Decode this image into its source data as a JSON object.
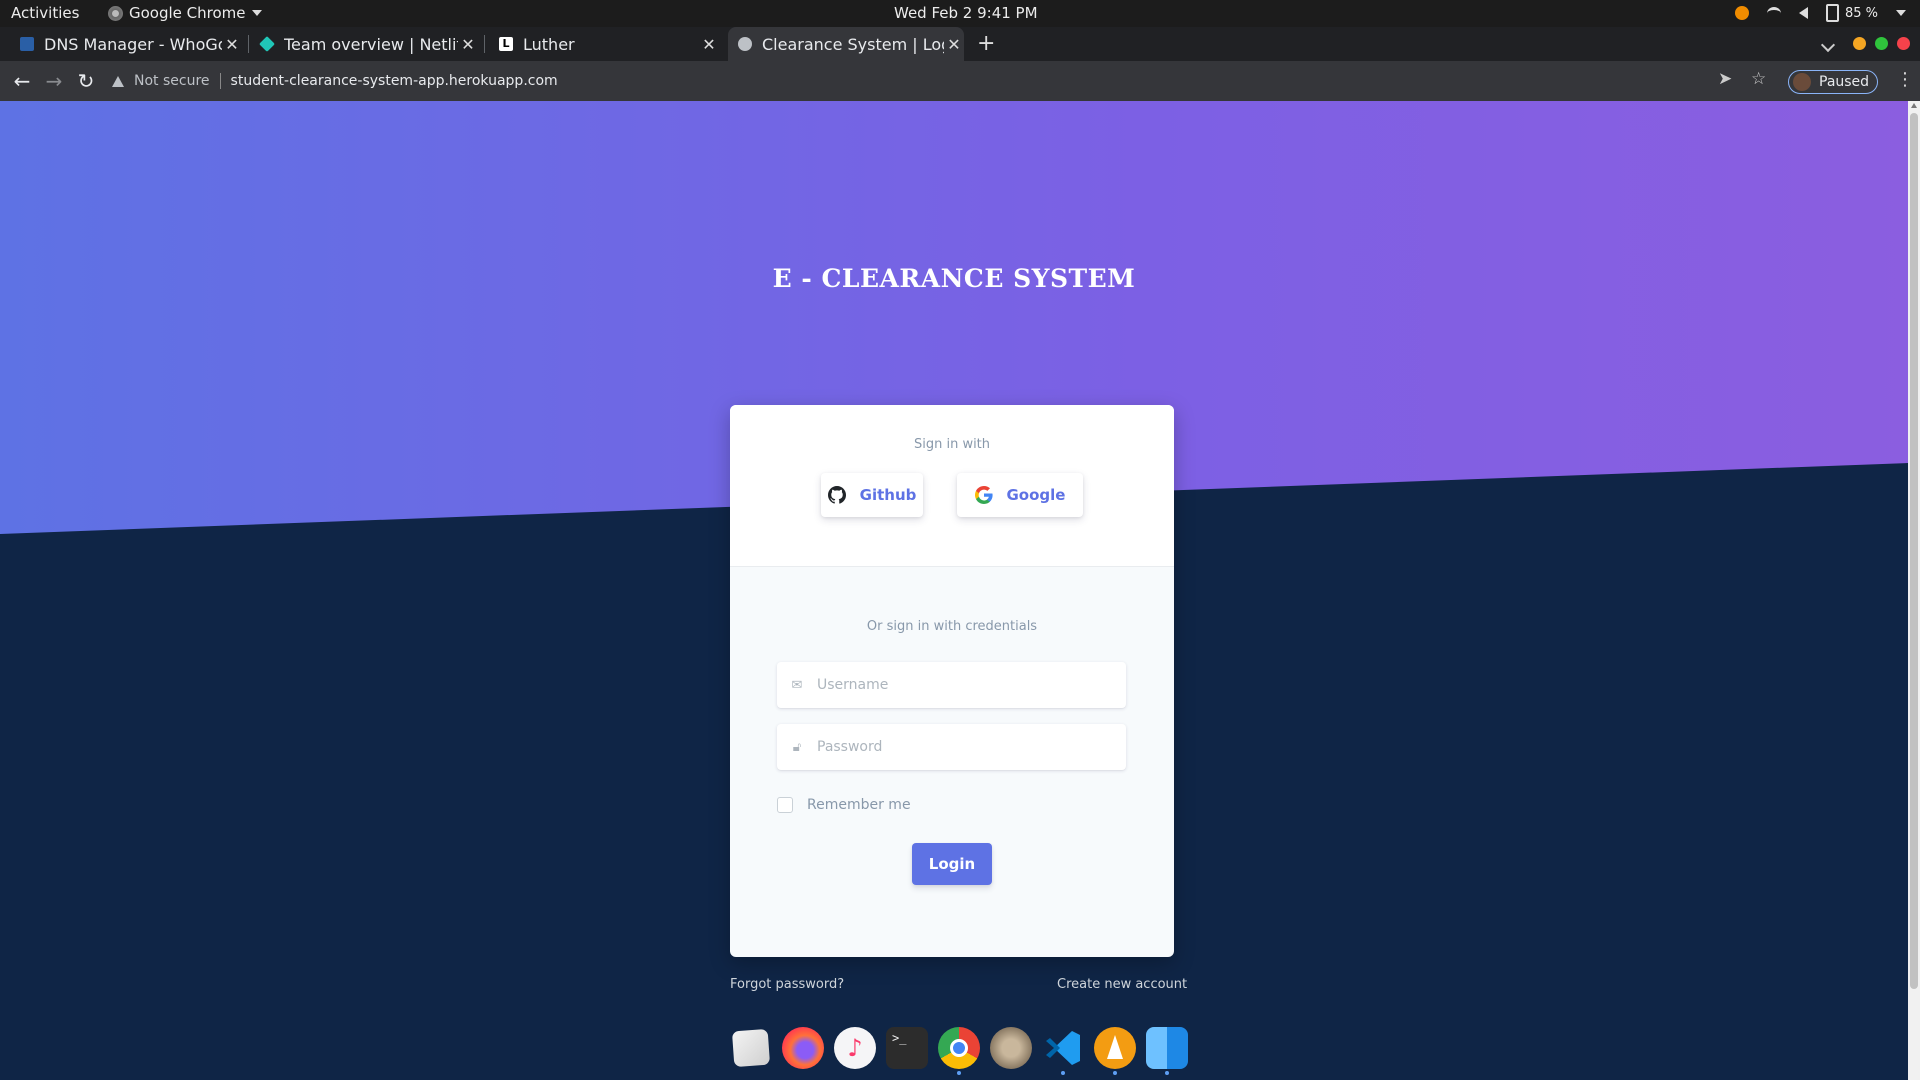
{
  "system": {
    "activities": "Activities",
    "app_name": "Google Chrome",
    "clock": "Wed Feb 2   9:41 PM",
    "battery": "85 %"
  },
  "tabs": [
    {
      "title": "DNS Manager - WhoGoH",
      "favicon_color": "#2a5fa6"
    },
    {
      "title": "Team overview | Netlify",
      "favicon_color": "#20c6b7"
    },
    {
      "title": "Luther",
      "favicon_color": "#ffffff"
    },
    {
      "title": "Clearance System | Login",
      "favicon_color": "#bdc1c6"
    }
  ],
  "omnibox": {
    "security": "Not secure",
    "url": "student-clearance-system-app.herokuapp.com"
  },
  "profile": {
    "label": "Paused"
  },
  "page": {
    "heading": "E - CLEARANCE SYSTEM",
    "sign_in_with": "Sign in with",
    "github_label": "Github",
    "google_label": "Google",
    "credentials_label": "Or sign in with credentials",
    "username_placeholder": "Username",
    "password_placeholder": "Password",
    "remember_label": "Remember me",
    "login_label": "Login",
    "forgot_password": "Forgot password?",
    "create_account": "Create new account"
  },
  "colors": {
    "primary": "#5e72e4",
    "hero_end": "#8b5ee0",
    "background": "#0f2546"
  },
  "dock": [
    "text-editor-icon",
    "firefox-icon",
    "music-icon",
    "terminal-icon",
    "chrome-icon",
    "photo-app-icon",
    "vscode-icon",
    "vlc-icon",
    "finder-icon"
  ]
}
